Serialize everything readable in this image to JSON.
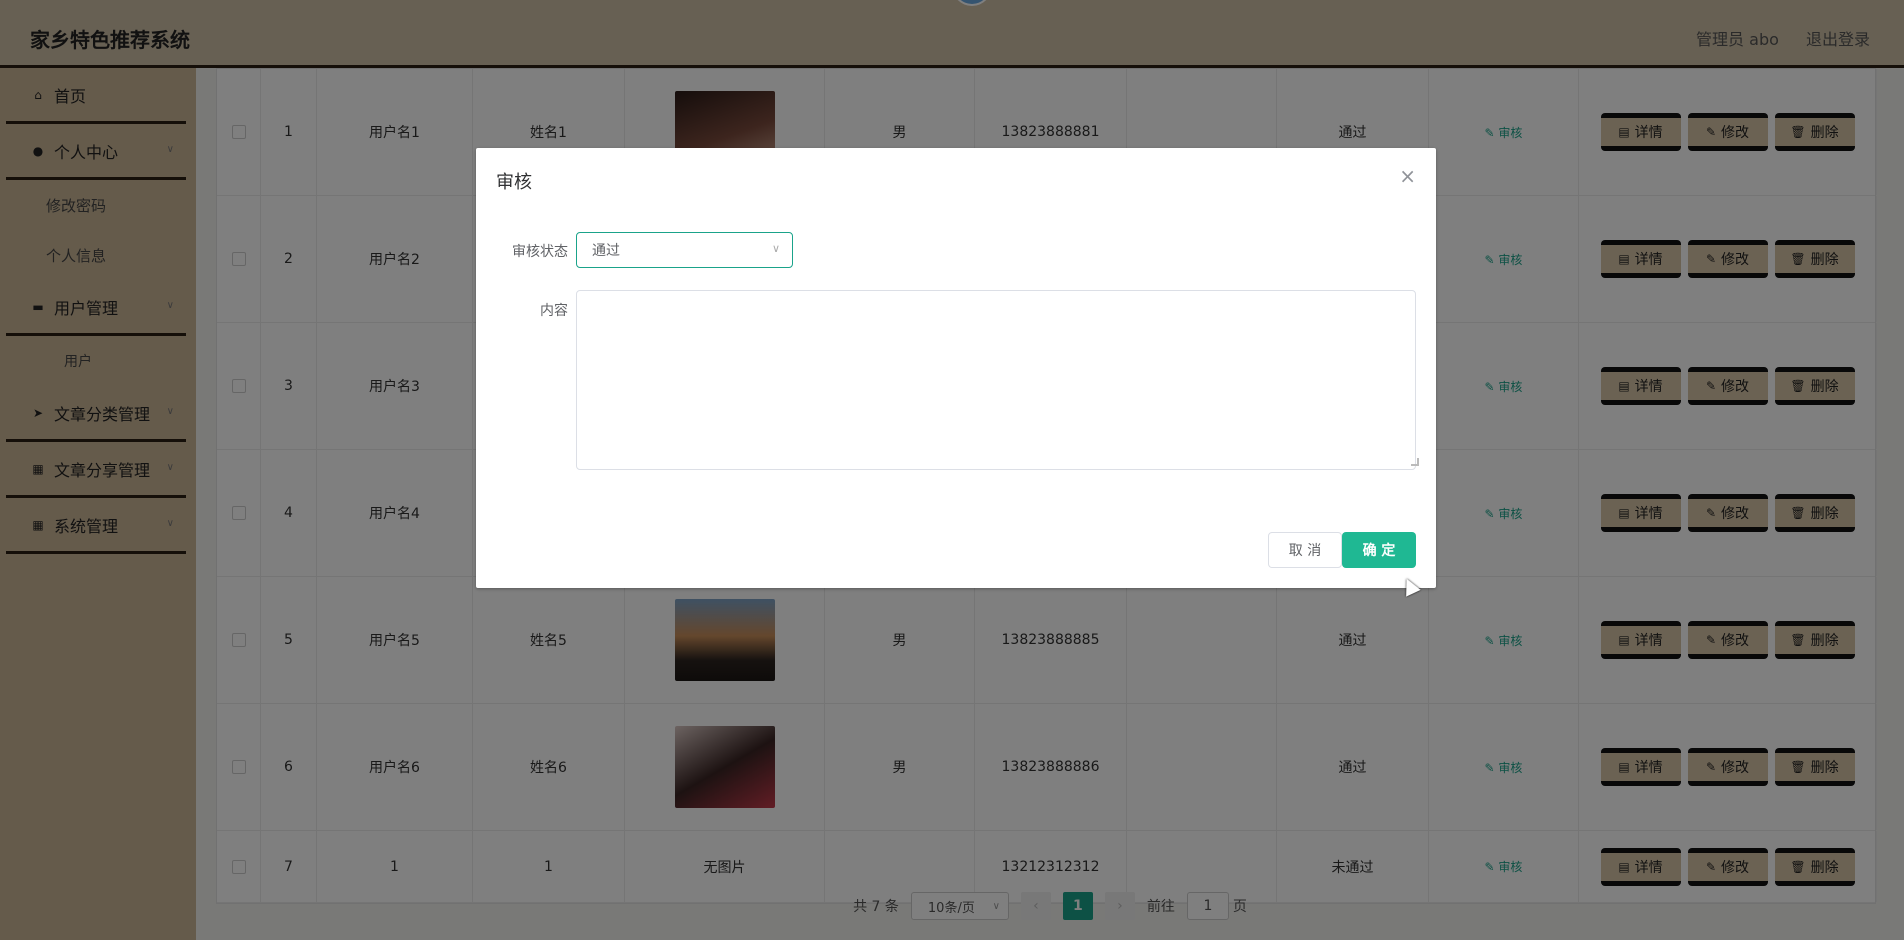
{
  "header": {
    "title": "家乡特色推荐系统",
    "user": "管理员 abo",
    "logout": "退出登录"
  },
  "sidebar": {
    "items": [
      {
        "label": "首页",
        "icon": "home-icon",
        "glyph": "⌂"
      },
      {
        "label": "个人中心",
        "icon": "user-icon",
        "glyph": "●",
        "children": [
          "修改密码",
          "个人信息"
        ]
      },
      {
        "label": "用户管理",
        "icon": "ticket-icon",
        "glyph": "▬",
        "children": [
          "用户"
        ]
      },
      {
        "label": "文章分类管理",
        "icon": "send-icon",
        "glyph": "➤"
      },
      {
        "label": "文章分享管理",
        "icon": "grid-icon",
        "glyph": "▦"
      },
      {
        "label": "系统管理",
        "icon": "grid-icon",
        "glyph": "▦"
      }
    ]
  },
  "table": {
    "rows": [
      {
        "index": "1",
        "username": "用户名1",
        "name": "姓名1",
        "photo": "img",
        "gender": "男",
        "phone": "13823888881",
        "status": "通过"
      },
      {
        "index": "2",
        "username": "用户名2",
        "name": "",
        "photo": "",
        "gender": "",
        "phone": "",
        "status": ""
      },
      {
        "index": "3",
        "username": "用户名3",
        "name": "",
        "photo": "",
        "gender": "",
        "phone": "",
        "status": ""
      },
      {
        "index": "4",
        "username": "用户名4",
        "name": "",
        "photo": "",
        "gender": "",
        "phone": "",
        "status": ""
      },
      {
        "index": "5",
        "username": "用户名5",
        "name": "姓名5",
        "photo": "img",
        "gender": "男",
        "phone": "13823888885",
        "status": "通过"
      },
      {
        "index": "6",
        "username": "用户名6",
        "name": "姓名6",
        "photo": "img",
        "gender": "男",
        "phone": "13823888886",
        "status": "通过"
      },
      {
        "index": "7",
        "username": "1",
        "name": "1",
        "photo": "无图片",
        "gender": "",
        "phone": "13212312312",
        "status": "未通过"
      }
    ],
    "audit_label": "审核",
    "detail_label": "详情",
    "edit_label": "修改",
    "delete_label": "删除"
  },
  "pager": {
    "total": "共 7 条",
    "page_size": "10条/页",
    "current": "1",
    "goto_prefix": "前往",
    "goto_value": "1",
    "goto_suffix": "页"
  },
  "dialog": {
    "title": "审核",
    "status_label": "审核状态",
    "status_value": "通过",
    "content_label": "内容",
    "content_value": "",
    "cancel": "取 消",
    "confirm": "确 定"
  },
  "colors": {
    "accent": "#1aa38a",
    "header_bg": "#cfc0a7",
    "sidebar_bg": "#cbb697"
  }
}
